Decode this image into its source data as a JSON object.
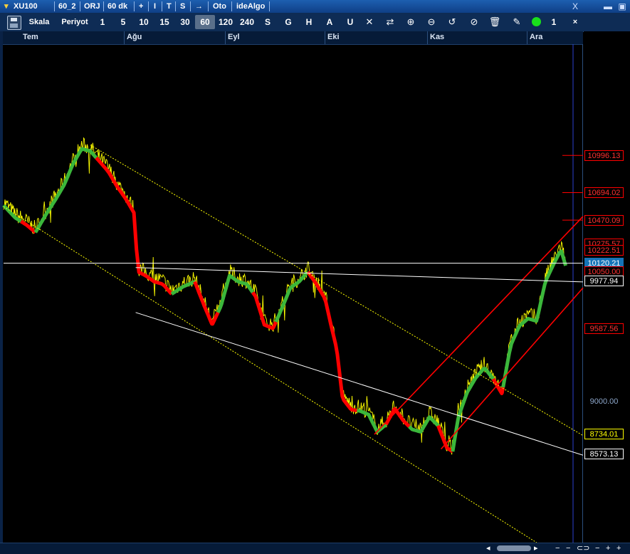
{
  "titlebar": {
    "items": [
      "XU100",
      "60_2",
      "ORJ",
      "60 dk",
      "+",
      "I",
      "T",
      "S",
      "→",
      "Oto",
      "ideAlgo"
    ],
    "close": "X"
  },
  "toolbar": {
    "skala": "Skala",
    "periyot": "Periyot",
    "periods": [
      "1",
      "5",
      "10",
      "15",
      "30",
      "60",
      "120",
      "240",
      "S",
      "G",
      "H",
      "A",
      "U"
    ],
    "active_period": "60",
    "count": "1",
    "close": "×"
  },
  "chart_data": {
    "type": "line",
    "x_months": [
      "Tem",
      "Ağu",
      "Eyl",
      "Eki",
      "Kas",
      "Ara"
    ],
    "ylim": [
      7850,
      11900
    ],
    "price_series_color": "#ffff00",
    "trend_up_color": "#3bb73b",
    "trend_down_color": "#ff0000",
    "price_path": [
      [
        0.0,
        10620
      ],
      [
        0.02,
        10520
      ],
      [
        0.04,
        10460
      ],
      [
        0.055,
        10400
      ],
      [
        0.065,
        10480
      ],
      [
        0.075,
        10560
      ],
      [
        0.09,
        10670
      ],
      [
        0.105,
        10790
      ],
      [
        0.12,
        10960
      ],
      [
        0.135,
        11080
      ],
      [
        0.15,
        11060
      ],
      [
        0.165,
        10980
      ],
      [
        0.18,
        10900
      ],
      [
        0.195,
        10780
      ],
      [
        0.21,
        10680
      ],
      [
        0.225,
        10560
      ],
      [
        0.232,
        10080
      ],
      [
        0.245,
        10050
      ],
      [
        0.26,
        10000
      ],
      [
        0.275,
        9980
      ],
      [
        0.29,
        9900
      ],
      [
        0.31,
        9960
      ],
      [
        0.33,
        10000
      ],
      [
        0.345,
        9820
      ],
      [
        0.36,
        9650
      ],
      [
        0.375,
        9800
      ],
      [
        0.39,
        10050
      ],
      [
        0.405,
        10000
      ],
      [
        0.42,
        9980
      ],
      [
        0.435,
        9880
      ],
      [
        0.45,
        9650
      ],
      [
        0.465,
        9620
      ],
      [
        0.48,
        9780
      ],
      [
        0.495,
        9950
      ],
      [
        0.51,
        10000
      ],
      [
        0.525,
        10080
      ],
      [
        0.54,
        9980
      ],
      [
        0.555,
        9860
      ],
      [
        0.565,
        9650
      ],
      [
        0.575,
        9450
      ],
      [
        0.585,
        9050
      ],
      [
        0.6,
        8960
      ],
      [
        0.615,
        8950
      ],
      [
        0.63,
        8920
      ],
      [
        0.645,
        8780
      ],
      [
        0.66,
        8840
      ],
      [
        0.675,
        8970
      ],
      [
        0.69,
        8870
      ],
      [
        0.705,
        8800
      ],
      [
        0.72,
        8780
      ],
      [
        0.735,
        8900
      ],
      [
        0.75,
        8830
      ],
      [
        0.765,
        8650
      ],
      [
        0.775,
        8620
      ],
      [
        0.785,
        8900
      ],
      [
        0.8,
        9100
      ],
      [
        0.815,
        9220
      ],
      [
        0.83,
        9300
      ],
      [
        0.845,
        9210
      ],
      [
        0.86,
        9090
      ],
      [
        0.875,
        9480
      ],
      [
        0.89,
        9640
      ],
      [
        0.905,
        9700
      ],
      [
        0.92,
        9680
      ],
      [
        0.935,
        10000
      ],
      [
        0.95,
        10150
      ],
      [
        0.962,
        10260
      ],
      [
        0.97,
        10130
      ]
    ],
    "trend_segments": [
      {
        "dir": "up",
        "from": 0.0,
        "to": 0.03
      },
      {
        "dir": "down",
        "from": 0.03,
        "to": 0.055
      },
      {
        "dir": "up",
        "from": 0.055,
        "to": 0.16
      },
      {
        "dir": "down",
        "from": 0.16,
        "to": 0.29
      },
      {
        "dir": "up",
        "from": 0.29,
        "to": 0.33
      },
      {
        "dir": "down",
        "from": 0.33,
        "to": 0.37
      },
      {
        "dir": "up",
        "from": 0.37,
        "to": 0.43
      },
      {
        "dir": "down",
        "from": 0.43,
        "to": 0.47
      },
      {
        "dir": "up",
        "from": 0.47,
        "to": 0.525
      },
      {
        "dir": "down",
        "from": 0.525,
        "to": 0.61
      },
      {
        "dir": "up",
        "from": 0.61,
        "to": 0.66
      },
      {
        "dir": "down",
        "from": 0.66,
        "to": 0.7
      },
      {
        "dir": "up",
        "from": 0.7,
        "to": 0.75
      },
      {
        "dir": "down",
        "from": 0.75,
        "to": 0.775
      },
      {
        "dir": "up",
        "from": 0.775,
        "to": 0.845
      },
      {
        "dir": "down",
        "from": 0.845,
        "to": 0.862
      },
      {
        "dir": "up",
        "from": 0.862,
        "to": 0.97
      }
    ],
    "trendlines": [
      {
        "color": "#ffff00",
        "style": "dotted",
        "from": [
          0.0,
          10580
        ],
        "to": [
          0.92,
          7850
        ]
      },
      {
        "color": "#ffff00",
        "style": "dotted",
        "from": [
          0.15,
          11080
        ],
        "to": [
          1.0,
          8720
        ]
      },
      {
        "color": "#ff0000",
        "style": "solid",
        "from": [
          0.64,
          8730
        ],
        "to": [
          1.0,
          10500
        ]
      },
      {
        "color": "#ff0000",
        "style": "solid",
        "from": [
          0.755,
          8610
        ],
        "to": [
          1.0,
          9920
        ]
      },
      {
        "color": "#ffffff",
        "style": "solid",
        "from": [
          0.228,
          10085
        ],
        "to": [
          1.0,
          9968
        ]
      },
      {
        "color": "#ffffff",
        "style": "solid",
        "from": [
          0.228,
          9720
        ],
        "to": [
          1.0,
          8560
        ]
      },
      {
        "color": "#ffffff",
        "style": "solid",
        "from": [
          0.0,
          10120
        ],
        "to": [
          1.0,
          10120
        ]
      }
    ],
    "price_labels": [
      {
        "value": 10996.13,
        "text": "10996.13",
        "color": "#ff3030",
        "bg": "#000000",
        "border": "#ff0000",
        "tick": true
      },
      {
        "value": 10694.02,
        "text": "10694.02",
        "color": "#ff3030",
        "bg": "#000000",
        "border": "#ff0000",
        "tick": true
      },
      {
        "value": 10470.09,
        "text": "10470.09",
        "color": "#ff3030",
        "bg": "#000000",
        "border": "#ff0000",
        "tick": true
      },
      {
        "value": 10275.57,
        "text": "10275.57",
        "color": "#ff3030",
        "bg": "#000000",
        "border": "#ff0000",
        "tick": false
      },
      {
        "value": 10222.51,
        "text": "10222.51",
        "color": "#ff3030",
        "bg": "#000000",
        "border": "#ff0000",
        "tick": false
      },
      {
        "value": 10120.21,
        "text": "10120.21",
        "color": "#ffffff",
        "bg": "#1573b7",
        "border": "#1573b7",
        "tick": false
      },
      {
        "value": 10050.0,
        "text": "10050.00",
        "color": "#ff3030",
        "bg": "#000000",
        "border": "#ff0000",
        "tick": false
      },
      {
        "value": 9977.94,
        "text": "9977.94",
        "color": "#ffffff",
        "bg": "#000000",
        "border": "#ffffff",
        "tick": false
      },
      {
        "value": 9587.56,
        "text": "9587.56",
        "color": "#ff3030",
        "bg": "#000000",
        "border": "#ff0000",
        "tick": false
      },
      {
        "value": 9000.0,
        "text": "9000.00",
        "color": "#8ea8cc",
        "bg": "#000000",
        "border": "#000000",
        "tick": false
      },
      {
        "value": 8734.01,
        "text": "8734.01",
        "color": "#ffff00",
        "bg": "#000000",
        "border": "#ffff00",
        "tick": false
      },
      {
        "value": 8573.13,
        "text": "8573.13",
        "color": "#ffffff",
        "bg": "#000000",
        "border": "#ffffff",
        "tick": false
      }
    ]
  }
}
